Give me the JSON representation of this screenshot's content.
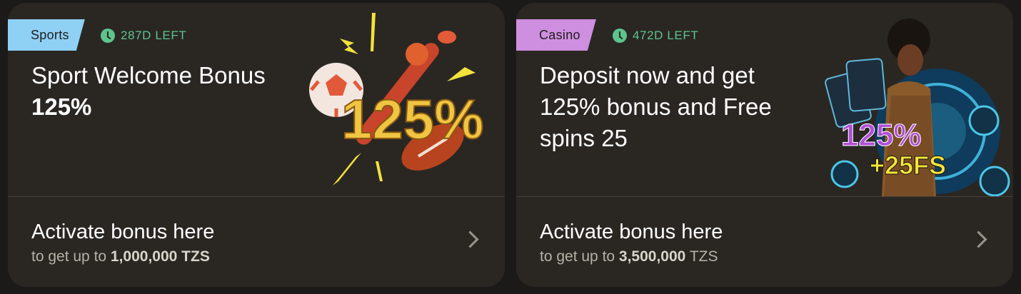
{
  "cards": [
    {
      "tag": "Sports",
      "timer": "287D LEFT",
      "title_part1": "Sport Welcome Bonus ",
      "title_bold": "125%",
      "art_text": "125%",
      "cta_title": "Activate bonus here",
      "cta_sub_prefix": "to get up to ",
      "cta_sub_amount": "1,000,000 TZS",
      "tag_color": "#8fd0f5"
    },
    {
      "tag": "Casino",
      "timer": "472D LEFT",
      "title": "Deposit now and get 125% bonus and Free spins 25",
      "art_text_line1": "125%",
      "art_text_line2": "+25FS",
      "cta_title": "Activate bonus here",
      "cta_sub_prefix": "to get up to ",
      "cta_sub_amount": "3,500,000",
      "cta_sub_suffix": " TZS",
      "tag_color": "#cf8fe0"
    }
  ]
}
